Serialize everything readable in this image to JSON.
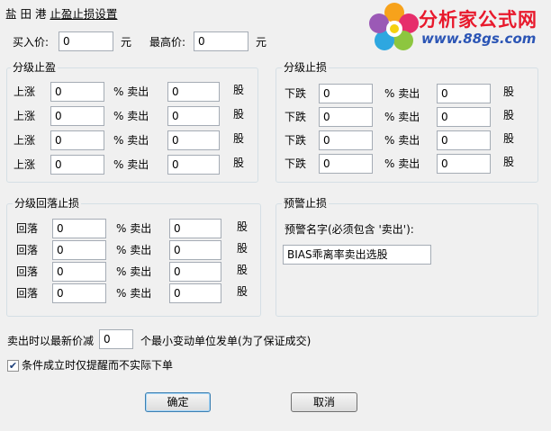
{
  "window": {
    "title_prefix": "盐 田 港 ",
    "title_main": "止盈止损设置"
  },
  "logo": {
    "name": "分析家公式网",
    "url": "www.88gs.com"
  },
  "top": {
    "buy_price_label": "买入价:",
    "buy_price_value": "0",
    "buy_unit": "元",
    "high_price_label": "最高价:",
    "high_price_value": "0",
    "high_unit": "元"
  },
  "take_profit": {
    "title": "分级止盈",
    "rows": [
      {
        "label": "上涨",
        "pct": "0",
        "pct_label": "% 卖出",
        "qty": "0",
        "unit": "股"
      },
      {
        "label": "上涨",
        "pct": "0",
        "pct_label": "% 卖出",
        "qty": "0",
        "unit": "股"
      },
      {
        "label": "上涨",
        "pct": "0",
        "pct_label": "% 卖出",
        "qty": "0",
        "unit": "股"
      },
      {
        "label": "上涨",
        "pct": "0",
        "pct_label": "% 卖出",
        "qty": "0",
        "unit": "股"
      }
    ]
  },
  "stop_loss": {
    "title": "分级止损",
    "rows": [
      {
        "label": "下跌",
        "pct": "0",
        "pct_label": "% 卖出",
        "qty": "0",
        "unit": "股"
      },
      {
        "label": "下跌",
        "pct": "0",
        "pct_label": "% 卖出",
        "qty": "0",
        "unit": "股"
      },
      {
        "label": "下跌",
        "pct": "0",
        "pct_label": "% 卖出",
        "qty": "0",
        "unit": "股"
      },
      {
        "label": "下跌",
        "pct": "0",
        "pct_label": "% 卖出",
        "qty": "0",
        "unit": "股"
      }
    ]
  },
  "pullback": {
    "title": "分级回落止损",
    "rows": [
      {
        "label": "回落",
        "pct": "0",
        "pct_label": "% 卖出",
        "qty": "0",
        "unit": "股"
      },
      {
        "label": "回落",
        "pct": "0",
        "pct_label": "% 卖出",
        "qty": "0",
        "unit": "股"
      },
      {
        "label": "回落",
        "pct": "0",
        "pct_label": "% 卖出",
        "qty": "0",
        "unit": "股"
      },
      {
        "label": "回落",
        "pct": "0",
        "pct_label": "% 卖出",
        "qty": "0",
        "unit": "股"
      }
    ]
  },
  "warning": {
    "title": "预警止损",
    "name_label": "预警名字(必须包含 '卖出'):",
    "name_value": "BIAS乖离率卖出选股"
  },
  "bottom": {
    "sell_prefix": "卖出时以最新价减",
    "sell_ticks_value": "0",
    "sell_suffix": "个最小变动单位发单(为了保证成交)",
    "remind_only_label": "条件成立时仅提醒而不实际下单",
    "remind_only_checked": true,
    "ok_label": "确定",
    "cancel_label": "取消"
  }
}
